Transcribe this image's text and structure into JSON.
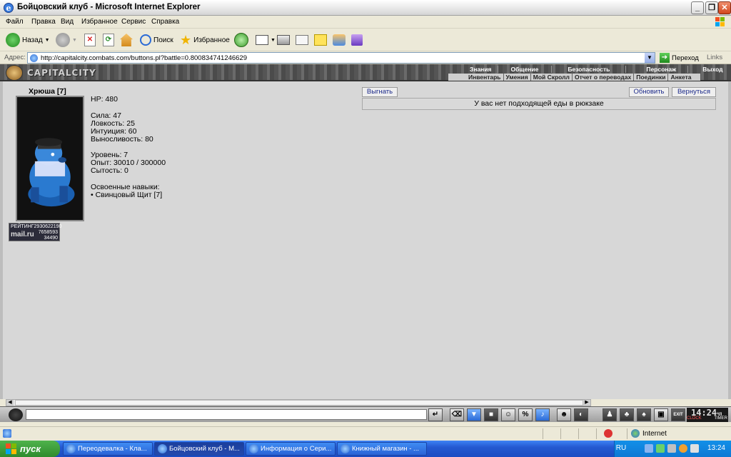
{
  "window": {
    "title": "Бойцовский клуб - Microsoft Internet Explorer",
    "min_label": "_",
    "max_label": "❐",
    "close_label": "✕"
  },
  "menu": {
    "items": [
      "Файл",
      "Правка",
      "Вид",
      "Избранное",
      "Сервис",
      "Справка"
    ]
  },
  "toolbar": {
    "back_label": "Назад",
    "search_label": "Поиск",
    "favorites_label": "Избранное"
  },
  "address": {
    "label": "Адрес:",
    "url": "http://capitalcity.combats.com/buttons.pl?battle=0.800834741246629",
    "go_label": "Переход",
    "links_label": "Links"
  },
  "game": {
    "logo": "CAPITALCITY",
    "nav_top": [
      "Знания",
      "Общение",
      "Безопасность",
      "Персонаж",
      "Выход"
    ],
    "nav_bottom": [
      "Инвентарь",
      "Умения",
      "Мой Скролл",
      "Отчет о переводах",
      "Поединки",
      "Анкета"
    ]
  },
  "character": {
    "name": "Хрюша [7]",
    "hp": "HP: 480",
    "stats": [
      "Сила: 47",
      "Ловкость: 25",
      "Интуиция: 60",
      "Выносливость: 80"
    ],
    "level": "Уровень: 7",
    "exp": "Опыт: 30010 / 300000",
    "satiety": "Сытость: 0",
    "skills_title": "Освоенные навыки:",
    "skills": [
      "• Свинцовый Щит [7]"
    ]
  },
  "counter": {
    "rating_label": "РЕЙТИНГ",
    "rating_value": "2930622190",
    "brand": "mail.ru",
    "v1": "7658593",
    "v2": "34490"
  },
  "actions": {
    "kick_label": "Выгнать",
    "refresh_label": "Обновить",
    "back_label": "Вернуться",
    "message": "У вас нет подходящей еды в рюкзаке"
  },
  "chatbar": {
    "clock": "14:24",
    "clock_suffix": "ЧЛ",
    "clock_label": "CLOCK",
    "timer_label": "TIMER",
    "exit_label": "EXIT"
  },
  "statusbar": {
    "zone": "Internet"
  },
  "taskbar": {
    "start_label": "пуск",
    "tasks": [
      {
        "label": "Переодевалка - Кла...",
        "active": false
      },
      {
        "label": "Бойцовский клуб - M...",
        "active": true
      },
      {
        "label": "Информация о Сери...",
        "active": false
      },
      {
        "label": "Книжный магазин - ...",
        "active": false
      }
    ],
    "lang": "RU",
    "time": "13:24"
  }
}
